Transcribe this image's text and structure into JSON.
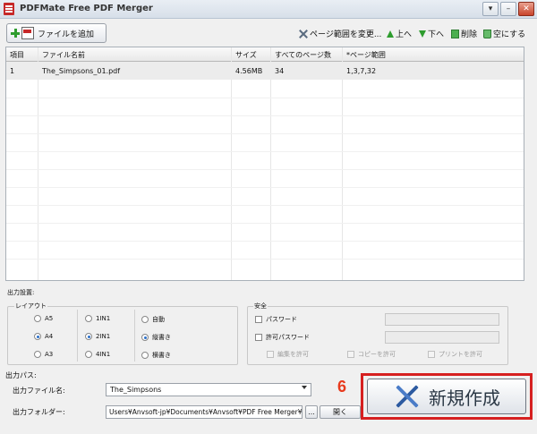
{
  "window": {
    "title": "PDFMate Free PDF Merger",
    "icon": "pdf-app-icon",
    "controls": [
      "chevron-down-icon",
      "minimize-icon",
      "close-icon"
    ]
  },
  "toolbar": {
    "add_file_label": "ファイルを追加",
    "set_page_range_label": "ページ範囲を変更...",
    "move_up_label": "上へ",
    "move_down_label": "下へ",
    "delete_label": "削除",
    "clear_label": "空にする"
  },
  "table": {
    "headers": [
      "項目",
      "ファイル名前",
      "サイズ",
      "すべてのページ数",
      "*ページ範囲"
    ],
    "rows": [
      {
        "index": "1",
        "filename": "The_Simpsons_01.pdf",
        "size": "4.56MB",
        "pages": "34",
        "range": "1,3,7,32"
      }
    ]
  },
  "output_settings": {
    "label": "出力設置:",
    "layout": {
      "title": "レイアウト",
      "page_sizes": [
        {
          "label": "A5",
          "selected": false
        },
        {
          "label": "A4",
          "selected": true
        },
        {
          "label": "A3",
          "selected": false
        }
      ],
      "pages_per_sheet": [
        {
          "label": "1IN1",
          "selected": false
        },
        {
          "label": "2IN1",
          "selected": true
        },
        {
          "label": "4IN1",
          "selected": false
        }
      ],
      "orientation": [
        {
          "label": "自動",
          "selected": false
        },
        {
          "label": "縦書き",
          "selected": true
        },
        {
          "label": "横書き",
          "selected": false
        }
      ]
    },
    "security": {
      "title": "安全",
      "password_label": "パスワード",
      "permission_password_label": "許可パスワード",
      "allow_edit_label": "編集を許可",
      "allow_copy_label": "コピーを許可",
      "allow_print_label": "プリントを許可"
    }
  },
  "output_path": {
    "label": "出力パス:",
    "filename_label": "出力ファイル名:",
    "filename_value": "The_Simpsons",
    "folder_label": "出力フォルダー:",
    "folder_value": "Users¥Anvsoft-jp¥Documents¥Anvsoft¥PDF Free Merger¥output¥",
    "browse_label": "...",
    "open_label": "開く"
  },
  "annotation": {
    "step_number": "6",
    "color": "#d62020"
  },
  "create_button": {
    "label": "新規作成"
  }
}
